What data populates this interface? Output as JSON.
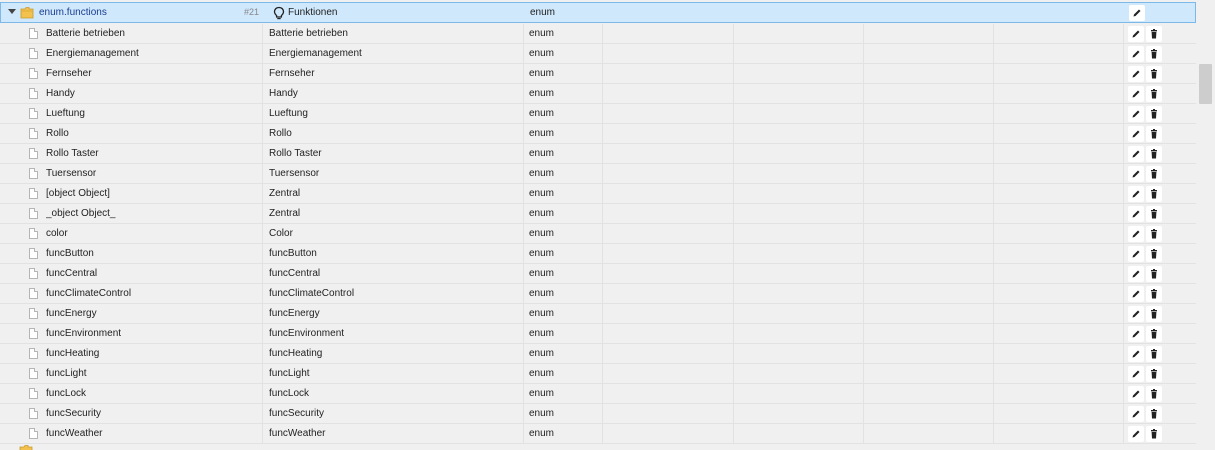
{
  "parent": {
    "id": "enum.functions",
    "num": "#21",
    "name": "Funktionen",
    "type": "enum"
  },
  "rows": [
    {
      "id": "Batterie betrieben",
      "name": "Batterie betrieben",
      "type": "enum"
    },
    {
      "id": "Energiemanagement",
      "name": "Energiemanagement",
      "type": "enum"
    },
    {
      "id": "Fernseher",
      "name": "Fernseher",
      "type": "enum"
    },
    {
      "id": "Handy",
      "name": "Handy",
      "type": "enum"
    },
    {
      "id": "Lueftung",
      "name": "Lueftung",
      "type": "enum"
    },
    {
      "id": "Rollo",
      "name": "Rollo",
      "type": "enum"
    },
    {
      "id": "Rollo Taster",
      "name": "Rollo Taster",
      "type": "enum"
    },
    {
      "id": "Tuersensor",
      "name": "Tuersensor",
      "type": "enum"
    },
    {
      "id": "[object Object]",
      "name": "Zentral",
      "type": "enum"
    },
    {
      "id": "_object Object_",
      "name": "Zentral",
      "type": "enum"
    },
    {
      "id": "color",
      "name": "Color",
      "type": "enum"
    },
    {
      "id": "funcButton",
      "name": "funcButton",
      "type": "enum"
    },
    {
      "id": "funcCentral",
      "name": "funcCentral",
      "type": "enum"
    },
    {
      "id": "funcClimateControl",
      "name": "funcClimateControl",
      "type": "enum"
    },
    {
      "id": "funcEnergy",
      "name": "funcEnergy",
      "type": "enum"
    },
    {
      "id": "funcEnvironment",
      "name": "funcEnvironment",
      "type": "enum"
    },
    {
      "id": "funcHeating",
      "name": "funcHeating",
      "type": "enum"
    },
    {
      "id": "funcLight",
      "name": "funcLight",
      "type": "enum"
    },
    {
      "id": "funcLock",
      "name": "funcLock",
      "type": "enum"
    },
    {
      "id": "funcSecurity",
      "name": "funcSecurity",
      "type": "enum"
    },
    {
      "id": "funcWeather",
      "name": "funcWeather",
      "type": "enum"
    }
  ],
  "icons": {
    "edit": "pencil-icon",
    "delete": "trash-icon",
    "folder": "folder-icon",
    "file": "file-icon",
    "function": "lightbulb-icon"
  },
  "colors": {
    "selected_bg": "#cfe8fc",
    "selected_border": "#7cb8e8",
    "folder": "#f2c14e"
  }
}
